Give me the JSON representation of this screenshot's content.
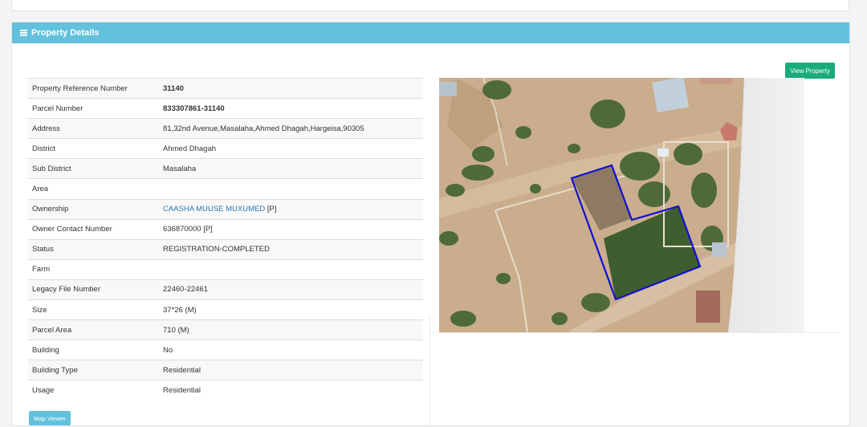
{
  "panel": {
    "title": "Property Details",
    "view_button": "View Property",
    "map_viewer_button": "Map Viewer"
  },
  "details": [
    {
      "label": "Property Reference Number",
      "value": "31140"
    },
    {
      "label": "Parcel Number",
      "value": "833307861-31140"
    },
    {
      "label": "Address",
      "value": "81,32nd Avenue,Masalaha,Ahmed Dhagah,Hargeisa,90305"
    },
    {
      "label": "District",
      "value": "Ahmed Dhagah"
    },
    {
      "label": "Sub District",
      "value": "Masalaha"
    },
    {
      "label": "Area",
      "value": ""
    },
    {
      "label": "Ownership",
      "value": "CAASHA MUUSE MUXUMED",
      "suffix": "[P]"
    },
    {
      "label": "Owner Contact Number",
      "value": "636870000 [P]"
    },
    {
      "label": "Status",
      "value": "REGISTRATION-COMPLETED"
    },
    {
      "label": "Farm",
      "value": ""
    },
    {
      "label": "Legacy File Number",
      "value": "22460-22461"
    },
    {
      "label": "Size",
      "value": "37*26 (M)"
    },
    {
      "label": "Parcel Area",
      "value": "710 (M)"
    },
    {
      "label": "Building",
      "value": "No"
    },
    {
      "label": "Building Type",
      "value": "Residential"
    },
    {
      "label": "Usage",
      "value": "Residential"
    }
  ],
  "colors": {
    "header": "#62c1dd",
    "view_button": "#1aab7b",
    "link": "#2a7ab8",
    "parcel_outline": "#1010d0"
  },
  "icons": {
    "header_icon": "list-icon"
  }
}
